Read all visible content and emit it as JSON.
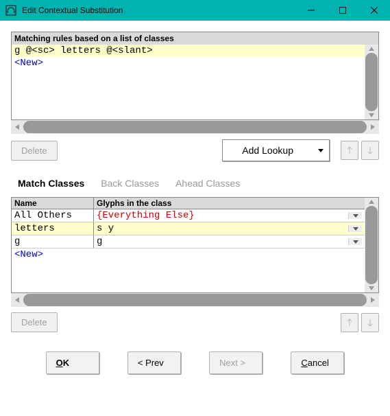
{
  "window": {
    "title": "Edit Contextual Substitution"
  },
  "rules": {
    "header": "Matching rules based on a list of classes",
    "rows": [
      {
        "text": "g @<sc> letters @<slant>",
        "selected": true
      },
      {
        "text": "<New>",
        "new": true
      }
    ]
  },
  "rules_controls": {
    "delete": "Delete",
    "add_lookup": "Add Lookup"
  },
  "tabs": {
    "match": "Match Classes",
    "back": "Back Classes",
    "ahead": "Ahead Classes"
  },
  "classes_table": {
    "col_name": "Name",
    "col_glyphs": "Glyphs in the class",
    "rows": [
      {
        "name": "All Others",
        "glyphs": "{Everything Else}",
        "glyphs_style": "red",
        "dropdown": true
      },
      {
        "name": "letters",
        "glyphs": "s y",
        "selected": true,
        "dropdown": true
      },
      {
        "name": "g",
        "glyphs": "g",
        "dropdown": true
      },
      {
        "name": "<New>",
        "glyphs": "",
        "new": true
      }
    ]
  },
  "classes_controls": {
    "delete": "Delete"
  },
  "footer": {
    "ok": "OK",
    "prev": "< Prev",
    "next": "Next >",
    "cancel": "Cancel"
  }
}
